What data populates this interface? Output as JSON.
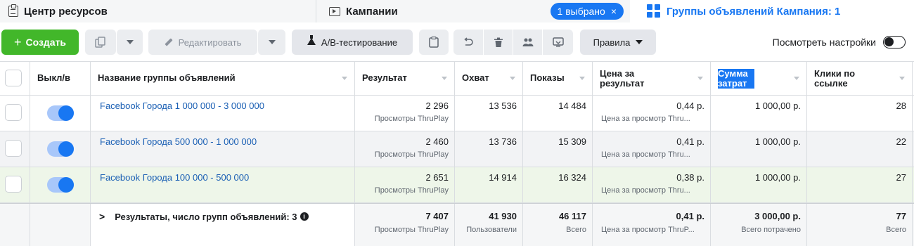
{
  "tabs": {
    "resources": "Центр ресурсов",
    "campaigns": "Кампании",
    "selected_pill": "1 выбрано",
    "selected_close": "×",
    "adsets": "Группы объявлений Кампания: 1"
  },
  "toolbar": {
    "create": "Создать",
    "create_plus": "+",
    "edit": "Редактировать",
    "ab_test": "A/B-тестирование",
    "rules": "Правила",
    "view_settings": "Посмотреть настройки"
  },
  "table": {
    "headers": {
      "toggle": "Выкл/в",
      "name": "Название группы объявлений",
      "result": "Результат",
      "reach": "Охват",
      "impressions": "Показы",
      "cost_per_result": "Цена за результат",
      "spent": "Сумма затрат",
      "link_clicks": "Клики по ссылке"
    },
    "rows": [
      {
        "name": "Facebook Города 1 000 000 - 3 000 000",
        "result": "2 296",
        "result_sub": "Просмотры ThruPlay",
        "reach": "13 536",
        "impressions": "14 484",
        "cost": "0,44 р.",
        "cost_sub": "Цена за просмотр Thru...",
        "spent": "1 000,00 р.",
        "clicks": "28"
      },
      {
        "name": "Facebook Города 500 000 - 1 000 000",
        "result": "2 460",
        "result_sub": "Просмотры ThruPlay",
        "reach": "13 736",
        "impressions": "15 309",
        "cost": "0,41 р.",
        "cost_sub": "Цена за просмотр Thru...",
        "spent": "1 000,00 р.",
        "clicks": "22"
      },
      {
        "name": "Facebook Города 100 000 - 500 000",
        "result": "2 651",
        "result_sub": "Просмотры ThruPlay",
        "reach": "14 914",
        "impressions": "16 324",
        "cost": "0,38 р.",
        "cost_sub": "Цена за просмотр Thru...",
        "spent": "1 000,00 р.",
        "clicks": "27"
      }
    ],
    "totals": {
      "label": "Результаты, число групп объявлений: 3",
      "chevron": ">",
      "info": "i",
      "result": "7 407",
      "result_sub": "Просмотры ThruPlay",
      "reach": "41 930",
      "reach_sub": "Пользователи",
      "impressions": "46 117",
      "impressions_sub": "Всего",
      "cost": "0,41 р.",
      "cost_sub": "Цена за просмотр ThruP...",
      "spent": "3 000,00 р.",
      "spent_sub": "Всего потрачено",
      "clicks": "77",
      "clicks_sub": "Всего"
    }
  },
  "colors": {
    "accent": "#1877f2",
    "create_green": "#42b72a",
    "highlight_row": "#eef6e9"
  }
}
